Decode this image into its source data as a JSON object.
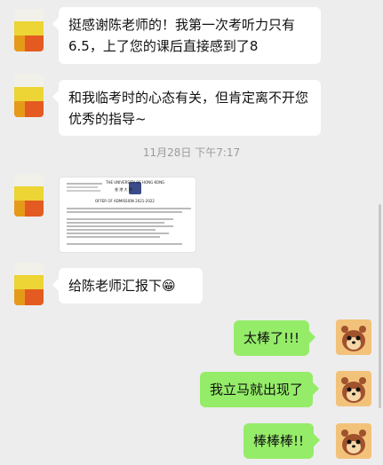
{
  "messages": [
    {
      "side": "left",
      "text": "挺感谢陈老师的！我第一次考听力只有6.5，上了您的课后直接感到了8"
    },
    {
      "side": "left",
      "text": "和我临考时的心态有关，但肯定离不开您优秀的指导~"
    },
    {
      "side": "left",
      "type": "image",
      "header": "THE UNIVERSITY OF HONG KONG",
      "sub": "香 港 大 學",
      "line1": "OFFER OF ADMISSION 2021-2022"
    },
    {
      "side": "left",
      "text": "给陈老师汇报下",
      "emoji": "😁"
    },
    {
      "side": "right",
      "text": "太棒了!!!"
    },
    {
      "side": "right",
      "text": "我立马就出现了"
    },
    {
      "side": "right",
      "text": "棒棒棒!!"
    }
  ],
  "timestamp": "11月28日 下午7:17",
  "icons": {
    "left_avatar": "user-avatar-icon",
    "right_avatar": "chipmunk-avatar-icon"
  }
}
